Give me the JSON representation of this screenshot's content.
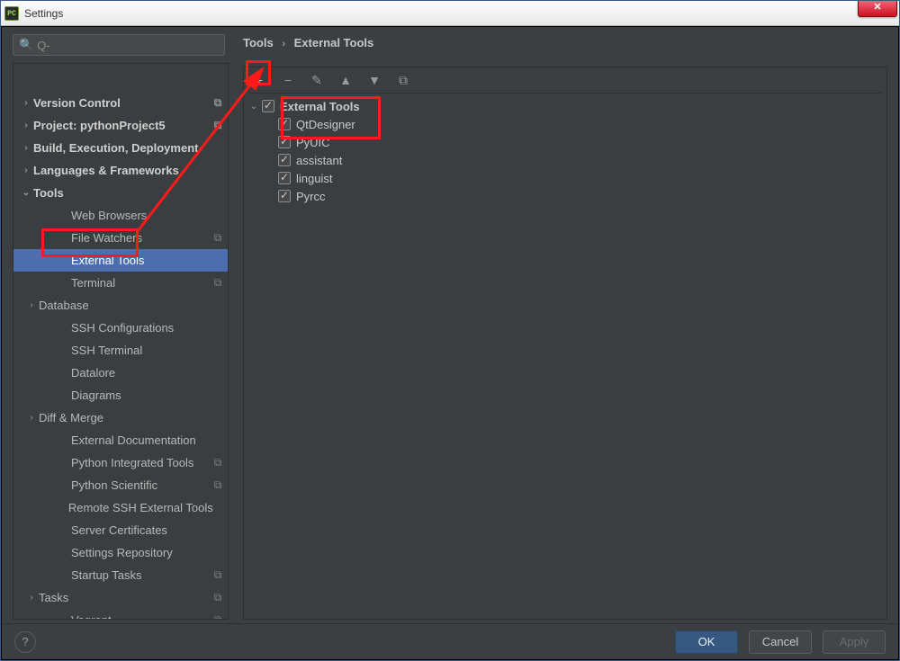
{
  "window": {
    "title": "Settings",
    "appicon": "PC"
  },
  "search": {
    "placeholder": "Q-"
  },
  "breadcrumb": {
    "root": "Tools",
    "leaf": "External Tools"
  },
  "sidebar": {
    "items": [
      {
        "label": "",
        "caret": "",
        "top": false,
        "tag": "",
        "lvl": 2,
        "selected": false
      },
      {
        "label": "Version Control",
        "caret": "›",
        "top": true,
        "tag": "⧉",
        "lvl": 0,
        "selected": false
      },
      {
        "label": "Project: pythonProject5",
        "caret": "›",
        "top": true,
        "tag": "⧉",
        "lvl": 0,
        "selected": false
      },
      {
        "label": "Build, Execution, Deployment",
        "caret": "›",
        "top": true,
        "tag": "",
        "lvl": 0,
        "selected": false
      },
      {
        "label": "Languages & Frameworks",
        "caret": "›",
        "top": true,
        "tag": "",
        "lvl": 0,
        "selected": false
      },
      {
        "label": "Tools",
        "caret": "⌄",
        "top": true,
        "tag": "",
        "lvl": 0,
        "selected": false
      },
      {
        "label": "Web Browsers",
        "caret": "",
        "top": false,
        "tag": "",
        "lvl": 2,
        "selected": false
      },
      {
        "label": "File Watchers",
        "caret": "",
        "top": false,
        "tag": "⧉",
        "lvl": 2,
        "selected": false
      },
      {
        "label": "External Tools",
        "caret": "",
        "top": false,
        "tag": "",
        "lvl": 2,
        "selected": true
      },
      {
        "label": "Terminal",
        "caret": "",
        "top": false,
        "tag": "⧉",
        "lvl": 2,
        "selected": false
      },
      {
        "label": "Database",
        "caret": "›",
        "top": false,
        "tag": "",
        "lvl": 1,
        "selected": false
      },
      {
        "label": "SSH Configurations",
        "caret": "",
        "top": false,
        "tag": "",
        "lvl": 2,
        "selected": false
      },
      {
        "label": "SSH Terminal",
        "caret": "",
        "top": false,
        "tag": "",
        "lvl": 2,
        "selected": false
      },
      {
        "label": "Datalore",
        "caret": "",
        "top": false,
        "tag": "",
        "lvl": 2,
        "selected": false
      },
      {
        "label": "Diagrams",
        "caret": "",
        "top": false,
        "tag": "",
        "lvl": 2,
        "selected": false
      },
      {
        "label": "Diff & Merge",
        "caret": "›",
        "top": false,
        "tag": "",
        "lvl": 1,
        "selected": false
      },
      {
        "label": "External Documentation",
        "caret": "",
        "top": false,
        "tag": "",
        "lvl": 2,
        "selected": false
      },
      {
        "label": "Python Integrated Tools",
        "caret": "",
        "top": false,
        "tag": "⧉",
        "lvl": 2,
        "selected": false
      },
      {
        "label": "Python Scientific",
        "caret": "",
        "top": false,
        "tag": "⧉",
        "lvl": 2,
        "selected": false
      },
      {
        "label": "Remote SSH External Tools",
        "caret": "",
        "top": false,
        "tag": "",
        "lvl": 2,
        "selected": false
      },
      {
        "label": "Server Certificates",
        "caret": "",
        "top": false,
        "tag": "",
        "lvl": 2,
        "selected": false
      },
      {
        "label": "Settings Repository",
        "caret": "",
        "top": false,
        "tag": "",
        "lvl": 2,
        "selected": false
      },
      {
        "label": "Startup Tasks",
        "caret": "",
        "top": false,
        "tag": "⧉",
        "lvl": 2,
        "selected": false
      },
      {
        "label": "Tasks",
        "caret": "›",
        "top": false,
        "tag": "⧉",
        "lvl": 1,
        "selected": false
      },
      {
        "label": "Vagrant",
        "caret": "",
        "top": false,
        "tag": "⧉",
        "lvl": 2,
        "selected": false
      }
    ]
  },
  "toolbar": {
    "add": "+",
    "remove": "−",
    "edit": "✎",
    "up": "▲",
    "down": "▼",
    "copy": "⧉"
  },
  "external_tools": {
    "group": "External Tools",
    "items": [
      {
        "name": "QtDesigner"
      },
      {
        "name": "PyUIC"
      },
      {
        "name": "assistant"
      },
      {
        "name": "linguist"
      },
      {
        "name": "Pyrcc"
      }
    ]
  },
  "buttons": {
    "ok": "OK",
    "cancel": "Cancel",
    "apply": "Apply",
    "help": "?"
  }
}
